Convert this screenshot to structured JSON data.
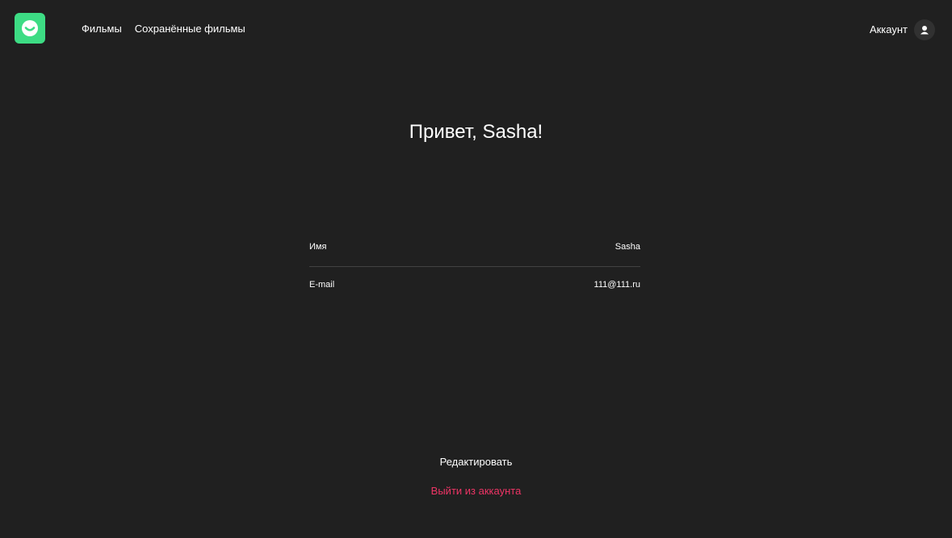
{
  "header": {
    "logo_icon": "smile-logo-icon",
    "nav": {
      "movies_label": "Фильмы",
      "saved_movies_label": "Сохранённые фильмы"
    },
    "account": {
      "label": "Аккаунт",
      "icon": "user-icon"
    }
  },
  "profile": {
    "greeting": "Привет, Sasha!",
    "fields": {
      "name": {
        "label": "Имя",
        "value": "Sasha"
      },
      "email": {
        "label": "E-mail",
        "value": "111@111.ru"
      }
    },
    "edit_label": "Редактировать",
    "logout_label": "Выйти из аккаунта"
  },
  "colors": {
    "background": "#202020",
    "accent": "#3ddc84",
    "logout": "#ee3465",
    "divider": "#424242"
  }
}
